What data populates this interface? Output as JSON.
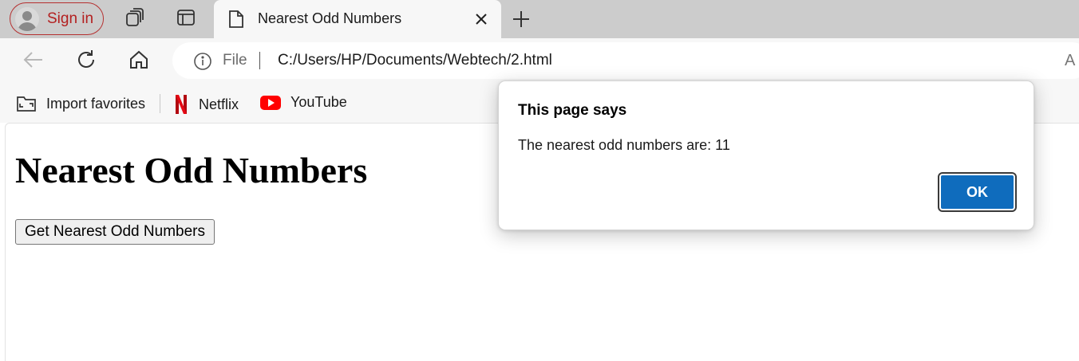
{
  "browser": {
    "profile": {
      "signin_label": "Sign in"
    },
    "active_tab": {
      "title": "Nearest Odd Numbers"
    },
    "address_bar": {
      "scheme_label": "File",
      "url": "C:/Users/HP/Documents/Webtech/2.html"
    },
    "favorites": [
      {
        "label": "Import favorites",
        "icon": "import-favorites-icon"
      },
      {
        "label": "Netflix",
        "icon": "netflix-icon"
      },
      {
        "label": "YouTube",
        "icon": "youtube-icon"
      }
    ]
  },
  "page": {
    "heading": "Nearest Odd Numbers",
    "button_label": "Get Nearest Odd Numbers"
  },
  "dialog": {
    "title": "This page says",
    "message": "The nearest odd numbers are: 11",
    "ok_label": "OK"
  },
  "colors": {
    "tabstrip": "#cccccc",
    "toolbar": "#f7f7f7",
    "signin_accent": "#b32020",
    "ok_button": "#0f6cbd",
    "netflix_red": "#e50914",
    "youtube_red": "#ff0000"
  }
}
